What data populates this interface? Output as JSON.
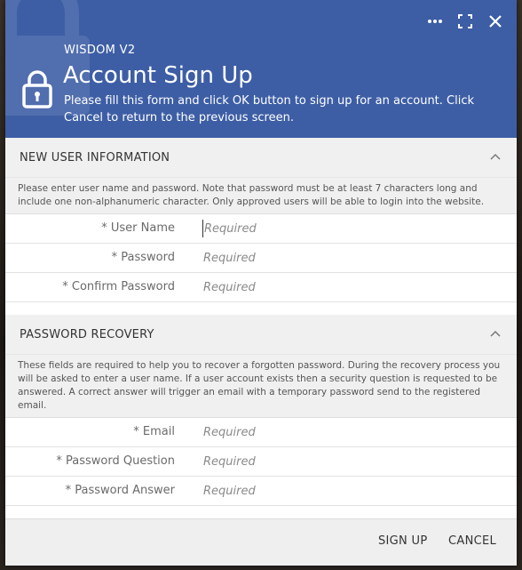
{
  "header": {
    "app_name": "WISDOM V2",
    "title": "Account Sign Up",
    "subtitle": "Please fill this form and click OK button to sign up for an account. Click Cancel to return to the previous screen."
  },
  "sections": [
    {
      "title": "NEW USER INFORMATION",
      "description": "Please enter user name and password. Note that password must be at least 7 characters long and include one non-alphanumeric character. Only approved users will be able to login into the website.",
      "fields": [
        {
          "label": "* User Name",
          "placeholder": "Required",
          "value": ""
        },
        {
          "label": "* Password",
          "placeholder": "Required",
          "value": ""
        },
        {
          "label": "* Confirm Password",
          "placeholder": "Required",
          "value": ""
        }
      ]
    },
    {
      "title": "PASSWORD RECOVERY",
      "description": "These fields are required to help you to recover a forgotten password. During the recovery process you will be asked to enter a user name. If a user account exists then a security question is requested to be answered. A correct answer will trigger an email with a temporary password send to the registered email.",
      "fields": [
        {
          "label": "* Email",
          "placeholder": "Required",
          "value": ""
        },
        {
          "label": "* Password Question",
          "placeholder": "Required",
          "value": ""
        },
        {
          "label": "* Password Answer",
          "placeholder": "Required",
          "value": ""
        }
      ]
    }
  ],
  "footer": {
    "signup_label": "SIGN UP",
    "cancel_label": "CANCEL"
  },
  "colors": {
    "header_bg": "#3d5ea5",
    "section_bg": "#f0f0f0"
  },
  "icons": [
    "more-icon",
    "maximize-icon",
    "close-icon",
    "lock-icon",
    "chevron-up-icon"
  ]
}
